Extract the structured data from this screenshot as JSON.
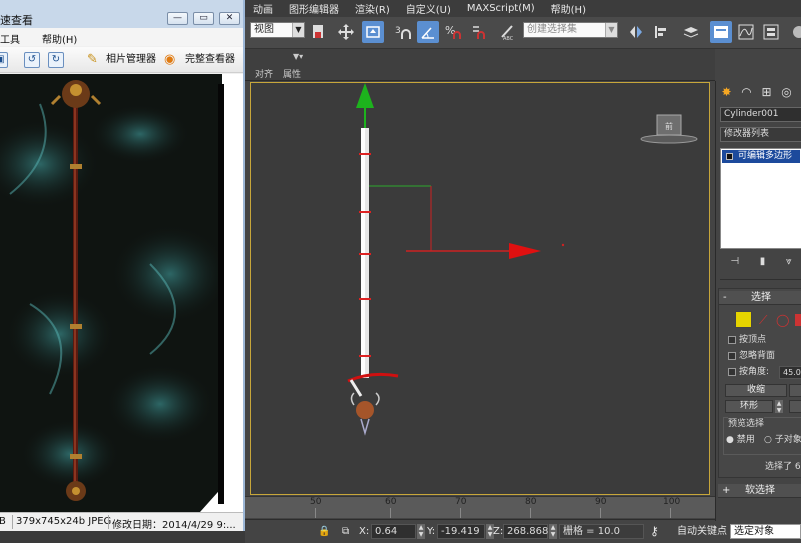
{
  "max": {
    "menu": [
      "动画",
      "图形编辑器",
      "渲染(R)",
      "自定义(U)",
      "MAXScript(M)",
      "帮助(H)"
    ],
    "toolbar": {
      "view_dropdown": "视图",
      "selection_set_placeholder": "创建选择集",
      "icons": [
        "select-link-icon",
        "move-icon",
        "select-region-icon",
        "snap-3-icon",
        "angle-snap-icon",
        "percent-snap-icon",
        "spinner-snap-icon",
        "edit-named-sets-icon",
        "mirror-icon",
        "align-icon",
        "layer-manager-icon",
        "ribbon-toggle-icon",
        "curve-editor-icon",
        "schematic-view-icon",
        "material-editor-icon"
      ]
    },
    "ribbon": {
      "labels": [
        "对齐",
        "属性"
      ]
    },
    "timeline": {
      "ticks": [
        "50",
        "60",
        "70",
        "80",
        "90",
        "100"
      ]
    },
    "status": {
      "x_label": "X:",
      "x_value": "0.64",
      "y_label": "Y:",
      "y_value": "-19.419",
      "z_label": "Z:",
      "z_value": "268.868",
      "grid_label": "栅格 = 10.0",
      "auto_key": "自动关键点",
      "selected_object": "选定对象"
    },
    "command_panel": {
      "object_name": "Cylinder001",
      "modifier_list": "修改器列表",
      "stack_item": "可编辑多边形",
      "selection_rollout": {
        "title": "选择",
        "sign": "-",
        "by_vertex": "按顶点",
        "ignore_backfacing": "忽略背面",
        "by_angle": "按角度:",
        "angle_value": "45.0",
        "shrink": "收缩",
        "ring": "环形",
        "preview_label": "预览选择",
        "disabled": "禁用",
        "subobject": "子对象",
        "selected_count": "选择了 6"
      },
      "soft_selection": {
        "sign": "+",
        "title": "软选择"
      }
    },
    "viewcube_label": "前"
  },
  "viewer": {
    "title": "速查看",
    "menu": [
      "工具",
      "帮助(H)"
    ],
    "tools": {
      "photo_manager": "相片管理器",
      "full_viewer": "完整查看器"
    },
    "status": {
      "size_unit": "B",
      "dims": "379x745x24b JPEG",
      "modified": "修改日期：2014/4/29 9:..."
    }
  }
}
